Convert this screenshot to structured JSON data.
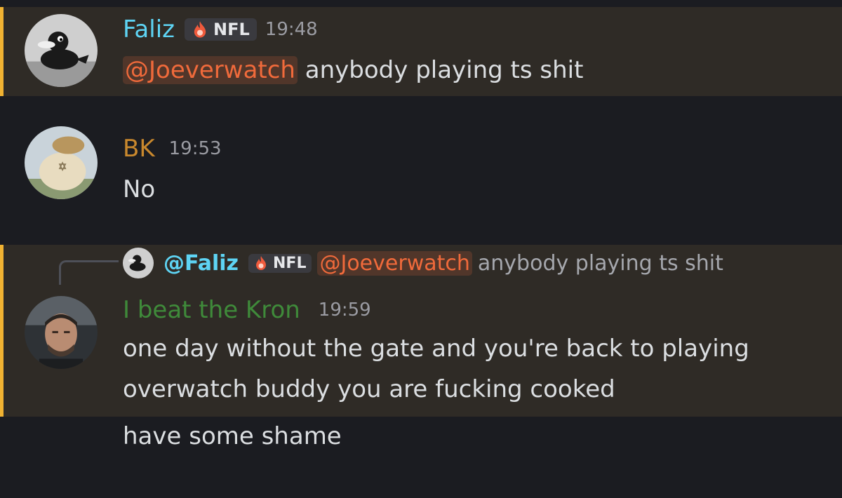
{
  "messages": [
    {
      "author": "Faliz",
      "author_color": "#5ed4f4",
      "tag": "NFL",
      "time": "19:48",
      "mention": "@Joeverwatch",
      "text": " anybody playing ts shit"
    },
    {
      "author": "BK",
      "author_color": "#c9882d",
      "time": "19:53",
      "text": "No"
    },
    {
      "reply": {
        "author": "@Faliz",
        "tag": "NFL",
        "mention": "@Joeverwatch",
        "text": "anybody playing ts shit"
      },
      "author": "I beat the Kron",
      "author_color": "#3f8a3a",
      "time": "19:59",
      "lines": [
        "one day without the gate and you're back to playing",
        "overwatch buddy you are fucking cooked"
      ]
    },
    {
      "text": "have some shame"
    }
  ],
  "colors": {
    "background": "#1b1c21",
    "highlight": "#2f2b26",
    "highlight_bar": "#f0b232",
    "mention": "#f06a3b"
  },
  "icons": [
    "flame-icon",
    "avatar-duck",
    "avatar-snorlax",
    "avatar-man"
  ]
}
